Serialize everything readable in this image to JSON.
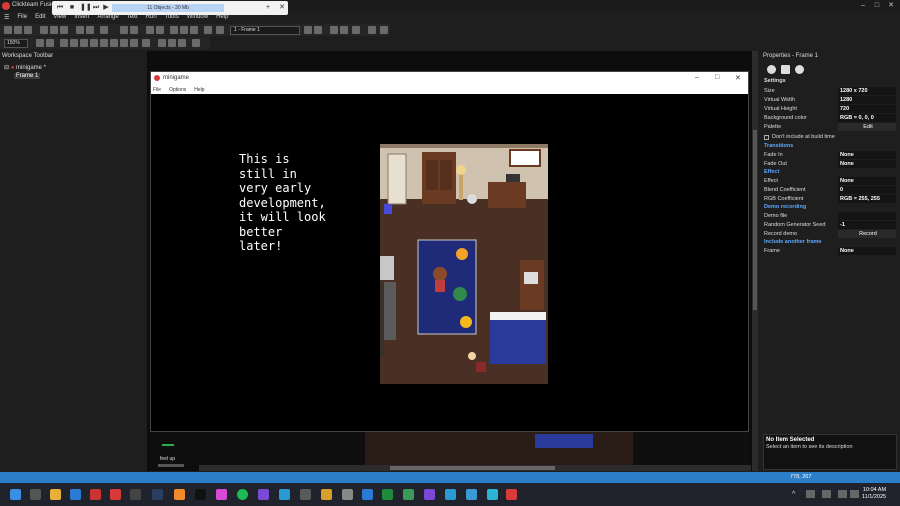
{
  "window": {
    "title": "Clickteam Fusion",
    "controls": [
      "–",
      "□",
      "✕"
    ]
  },
  "playbar": {
    "info": "11 Objects - 30 Mb"
  },
  "menu": [
    "File",
    "Edit",
    "View",
    "Insert",
    "Arrange",
    "Text",
    "Run",
    "Tools",
    "Window",
    "Help"
  ],
  "toolbar": {
    "frame_select": "1 - Frame 1",
    "zoom": "150%"
  },
  "workspace": {
    "title": "Workspace Toolbar",
    "app_node": "minigame *",
    "frame_node": "Frame 1"
  },
  "game_window": {
    "title": "minigame",
    "menu": [
      "File",
      "Options",
      "Help"
    ],
    "message": "This is\nstill in\nvery early\ndevelopment,\nit will look\nbetter\nlater!"
  },
  "bottom_strip": {
    "label": "feel up"
  },
  "properties": {
    "title": "Properties - Frame 1",
    "section_settings": "Settings",
    "rows_settings": [
      {
        "name": "Size",
        "value": "1280 x 720"
      },
      {
        "name": "Virtual Width",
        "value": "1280"
      },
      {
        "name": "Virtual Height",
        "value": "720"
      },
      {
        "name": "Background color",
        "value": "RGB = 0, 0, 0"
      },
      {
        "name": "Palette",
        "value": "Edit"
      }
    ],
    "checkbox_label": "Don't include at build time",
    "section_transitions": "Transitions",
    "rows_transitions": [
      {
        "name": "Fade In",
        "value": "None"
      },
      {
        "name": "Fade Out",
        "value": "None"
      }
    ],
    "section_effect": "Effect",
    "rows_effect": [
      {
        "name": "Effect",
        "value": "None"
      },
      {
        "name": "Blend Coefficient",
        "value": "0"
      },
      {
        "name": "RGB Coefficient",
        "value": "RGB = 255, 255"
      }
    ],
    "section_demo": "Demo recording",
    "rows_demo": [
      {
        "name": "Demo file",
        "value": ""
      },
      {
        "name": "Random Generator Seed",
        "value": "-1"
      },
      {
        "name": "Record demo",
        "value": "Record"
      }
    ],
    "section_include": "Include another frame",
    "rows_include": [
      {
        "name": "Frame",
        "value": "None"
      }
    ],
    "desc_title": "No Item Selected",
    "desc_body": "Select an item to see its description"
  },
  "statusbar": {
    "coords": "778, 267"
  },
  "taskbar": {
    "time": "10:04 AM",
    "date": "11/1/2025"
  },
  "colors": {
    "statusbar": "#2d7ec9",
    "section": "#5fa8ff",
    "app_icon": "#d83a3a"
  }
}
